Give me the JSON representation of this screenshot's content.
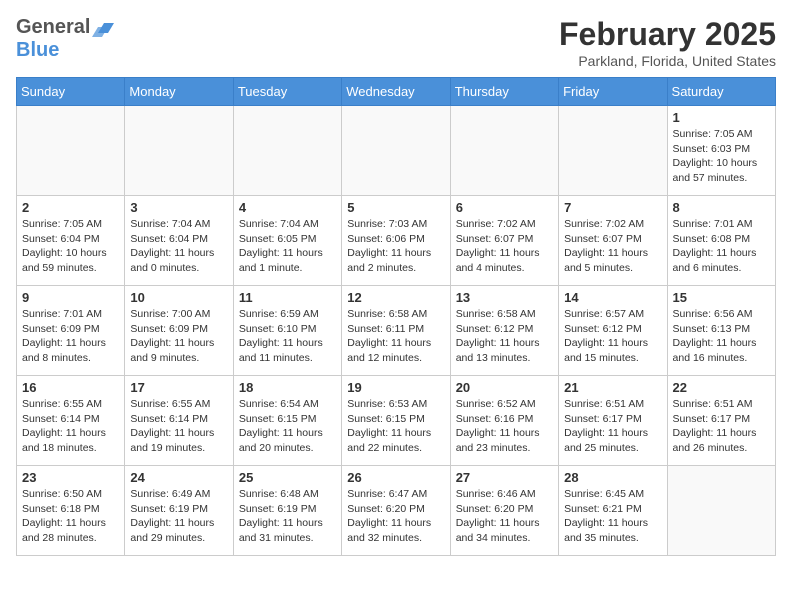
{
  "header": {
    "logo": {
      "general": "General",
      "blue": "Blue",
      "icon": "▲"
    },
    "title": "February 2025",
    "location": "Parkland, Florida, United States"
  },
  "calendar": {
    "days": [
      "Sunday",
      "Monday",
      "Tuesday",
      "Wednesday",
      "Thursday",
      "Friday",
      "Saturday"
    ],
    "weeks": [
      [
        {
          "day": null
        },
        {
          "day": null
        },
        {
          "day": null
        },
        {
          "day": null
        },
        {
          "day": null
        },
        {
          "day": null
        },
        {
          "day": 1,
          "sunrise": "7:05 AM",
          "sunset": "6:03 PM",
          "daylight": "10 hours and 57 minutes."
        }
      ],
      [
        {
          "day": 2,
          "sunrise": "7:05 AM",
          "sunset": "6:04 PM",
          "daylight": "10 hours and 59 minutes."
        },
        {
          "day": 3,
          "sunrise": "7:04 AM",
          "sunset": "6:04 PM",
          "daylight": "11 hours and 0 minutes."
        },
        {
          "day": 4,
          "sunrise": "7:04 AM",
          "sunset": "6:05 PM",
          "daylight": "11 hours and 1 minute."
        },
        {
          "day": 5,
          "sunrise": "7:03 AM",
          "sunset": "6:06 PM",
          "daylight": "11 hours and 2 minutes."
        },
        {
          "day": 6,
          "sunrise": "7:02 AM",
          "sunset": "6:07 PM",
          "daylight": "11 hours and 4 minutes."
        },
        {
          "day": 7,
          "sunrise": "7:02 AM",
          "sunset": "6:07 PM",
          "daylight": "11 hours and 5 minutes."
        },
        {
          "day": 8,
          "sunrise": "7:01 AM",
          "sunset": "6:08 PM",
          "daylight": "11 hours and 6 minutes."
        }
      ],
      [
        {
          "day": 9,
          "sunrise": "7:01 AM",
          "sunset": "6:09 PM",
          "daylight": "11 hours and 8 minutes."
        },
        {
          "day": 10,
          "sunrise": "7:00 AM",
          "sunset": "6:09 PM",
          "daylight": "11 hours and 9 minutes."
        },
        {
          "day": 11,
          "sunrise": "6:59 AM",
          "sunset": "6:10 PM",
          "daylight": "11 hours and 11 minutes."
        },
        {
          "day": 12,
          "sunrise": "6:58 AM",
          "sunset": "6:11 PM",
          "daylight": "11 hours and 12 minutes."
        },
        {
          "day": 13,
          "sunrise": "6:58 AM",
          "sunset": "6:12 PM",
          "daylight": "11 hours and 13 minutes."
        },
        {
          "day": 14,
          "sunrise": "6:57 AM",
          "sunset": "6:12 PM",
          "daylight": "11 hours and 15 minutes."
        },
        {
          "day": 15,
          "sunrise": "6:56 AM",
          "sunset": "6:13 PM",
          "daylight": "11 hours and 16 minutes."
        }
      ],
      [
        {
          "day": 16,
          "sunrise": "6:55 AM",
          "sunset": "6:14 PM",
          "daylight": "11 hours and 18 minutes."
        },
        {
          "day": 17,
          "sunrise": "6:55 AM",
          "sunset": "6:14 PM",
          "daylight": "11 hours and 19 minutes."
        },
        {
          "day": 18,
          "sunrise": "6:54 AM",
          "sunset": "6:15 PM",
          "daylight": "11 hours and 20 minutes."
        },
        {
          "day": 19,
          "sunrise": "6:53 AM",
          "sunset": "6:15 PM",
          "daylight": "11 hours and 22 minutes."
        },
        {
          "day": 20,
          "sunrise": "6:52 AM",
          "sunset": "6:16 PM",
          "daylight": "11 hours and 23 minutes."
        },
        {
          "day": 21,
          "sunrise": "6:51 AM",
          "sunset": "6:17 PM",
          "daylight": "11 hours and 25 minutes."
        },
        {
          "day": 22,
          "sunrise": "6:51 AM",
          "sunset": "6:17 PM",
          "daylight": "11 hours and 26 minutes."
        }
      ],
      [
        {
          "day": 23,
          "sunrise": "6:50 AM",
          "sunset": "6:18 PM",
          "daylight": "11 hours and 28 minutes."
        },
        {
          "day": 24,
          "sunrise": "6:49 AM",
          "sunset": "6:19 PM",
          "daylight": "11 hours and 29 minutes."
        },
        {
          "day": 25,
          "sunrise": "6:48 AM",
          "sunset": "6:19 PM",
          "daylight": "11 hours and 31 minutes."
        },
        {
          "day": 26,
          "sunrise": "6:47 AM",
          "sunset": "6:20 PM",
          "daylight": "11 hours and 32 minutes."
        },
        {
          "day": 27,
          "sunrise": "6:46 AM",
          "sunset": "6:20 PM",
          "daylight": "11 hours and 34 minutes."
        },
        {
          "day": 28,
          "sunrise": "6:45 AM",
          "sunset": "6:21 PM",
          "daylight": "11 hours and 35 minutes."
        },
        {
          "day": null
        }
      ]
    ]
  }
}
